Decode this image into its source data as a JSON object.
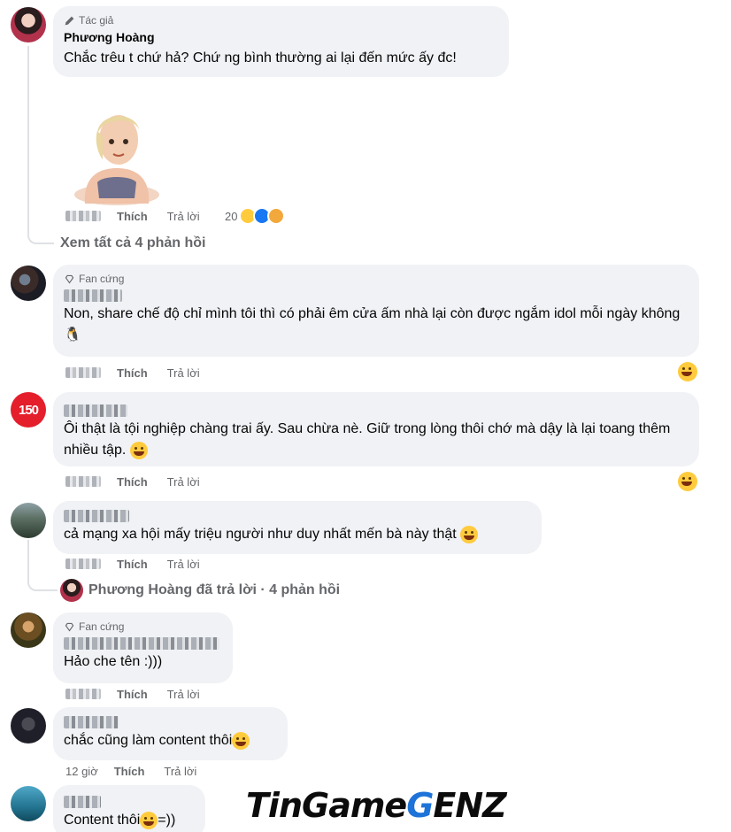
{
  "comments": [
    {
      "badge": "Tác giả",
      "author": "Phương Hoàng",
      "text": "Chắc trêu t chứ hả? Chứ ng bình thường ai lại đến mức ấy đc!",
      "like_label": "Thích",
      "reply_label": "Trả lời",
      "reaction_count": "20"
    },
    {
      "badge": "Fan cứng",
      "text": "Non, share chế độ chỉ mình tôi thì có phải êm cửa ấm nhà lại còn được ngắm idol mỗi ngày không 🐧",
      "like_label": "Thích",
      "reply_label": "Trả lời"
    },
    {
      "text": "Ôi thật là tội nghiệp chàng trai ấy. Sau chừa nè. Giữ trong lòng thôi chớ mà dậy là lại toang thêm nhiều tập.",
      "like_label": "Thích",
      "reply_label": "Trả lời"
    },
    {
      "text": "cả mạng xa hội mấy triệu người như duy nhất mến bà này thật",
      "like_label": "Thích",
      "reply_label": "Trả lời"
    },
    {
      "badge": "Fan cứng",
      "text": "Hảo che tên :)))",
      "like_label": "Thích",
      "reply_label": "Trả lời"
    },
    {
      "text": "chắc cũng làm content thôi",
      "time": "12 giờ",
      "like_label": "Thích",
      "reply_label": "Trả lời"
    },
    {
      "text": "Content thôi",
      "text_suffix": "=))"
    }
  ],
  "threads": {
    "see_all_replies": "Xem tất cả 4 phản hồi",
    "author_replied": "Phương Hoàng đã trả lời · 4 phản hồi"
  },
  "avatar3_label": "150",
  "watermark": "TinGameGENZ",
  "icons": {
    "author_badge": "pencil-icon",
    "fan_badge": "diamond-icon",
    "reaction_haha": "haha-emoji-icon",
    "reaction_like": "like-icon",
    "reaction_care": "care-emoji-icon"
  },
  "colors": {
    "bubble": "#f0f2f5",
    "secondary_text": "#65676b",
    "like_blue": "#1877f2",
    "logo_blue": "#1e73d8"
  }
}
